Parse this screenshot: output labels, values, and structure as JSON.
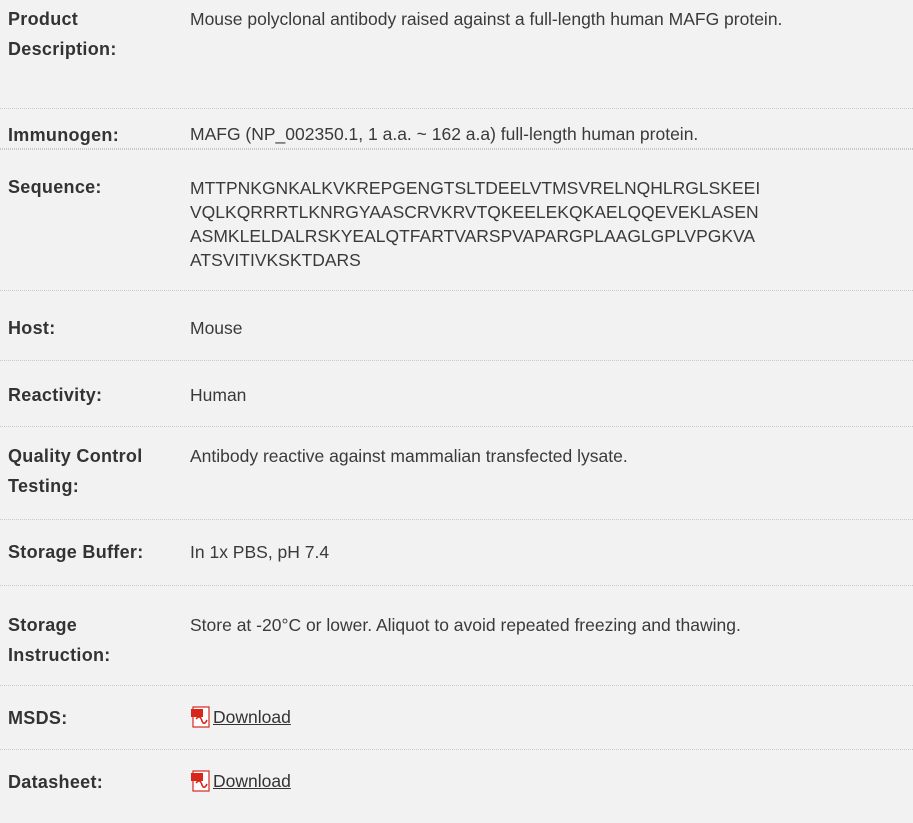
{
  "rows": {
    "product_description": {
      "label_line1": "Product",
      "label_line2": "Description:",
      "value": "Mouse polyclonal antibody raised against a full-length human MAFG protein."
    },
    "immunogen": {
      "label": "Immunogen:",
      "value": "MAFG (NP_002350.1, 1 a.a. ~ 162 a.a) full-length human protein."
    },
    "sequence": {
      "label": "Sequence:",
      "line1": "MTTPNKGNKALKVKREPGENGTSLTDEELVTMSVRELNQHLRGLSKEEI",
      "line2": "VQLKQRRRTLKNRGYAASCRVKRVTQKEELEKQKAELQQEVEKLASEN",
      "line3": "ASMKLELDALRSKYEALQTFARTVARSPVAPARGPLAAGLGPLVPGKVA",
      "line4": "ATSVITIVKSKTDARS"
    },
    "host": {
      "label": "Host:",
      "value": "Mouse"
    },
    "reactivity": {
      "label": "Reactivity:",
      "value": "Human"
    },
    "quality_control": {
      "label_line1": "Quality Control",
      "label_line2": "Testing:",
      "value": "Antibody reactive against mammalian transfected lysate."
    },
    "storage_buffer": {
      "label": "Storage Buffer:",
      "value": "In 1x PBS, pH 7.4"
    },
    "storage_instruction": {
      "label_line1": "Storage",
      "label_line2": "Instruction:",
      "value": "Store at -20°C or lower. Aliquot to avoid repeated freezing and thawing."
    },
    "msds": {
      "label": "MSDS:",
      "link_text": "Download",
      "icon": "pdf-icon"
    },
    "datasheet": {
      "label": "Datasheet:",
      "link_text": "Download",
      "icon": "pdf-icon"
    }
  },
  "colors": {
    "background": "#f2f2f2",
    "divider": "#c8c8c8",
    "text": "#333333",
    "pdf_red": "#d9261c"
  }
}
